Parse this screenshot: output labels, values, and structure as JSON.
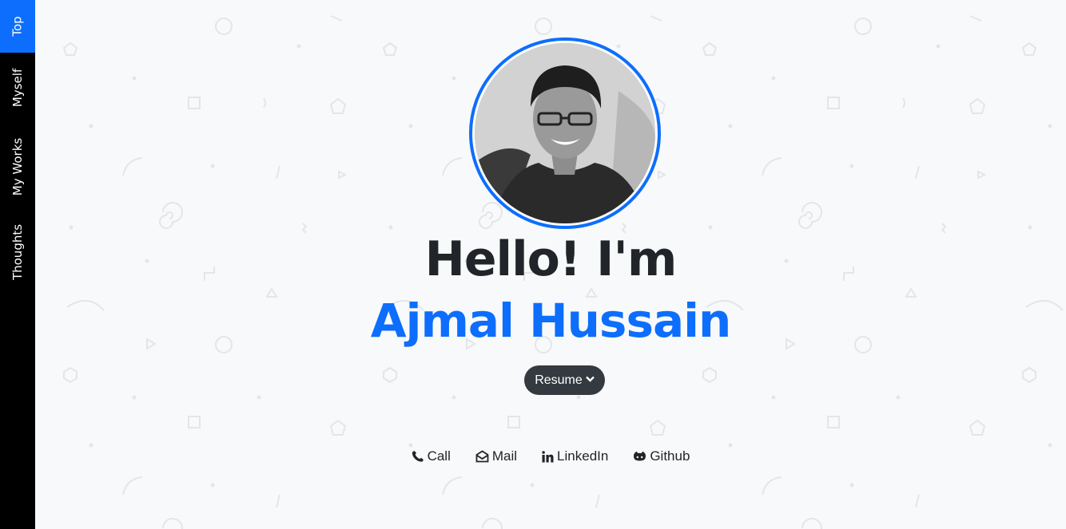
{
  "sidebar": {
    "items": [
      {
        "label": "Top"
      },
      {
        "label": "Myself"
      },
      {
        "label": "My Works"
      },
      {
        "label": "Thoughts"
      }
    ]
  },
  "hero": {
    "greeting": "Hello! I'm",
    "name": "Ajmal Hussain",
    "resume_label": "Resume"
  },
  "contacts": {
    "call": "Call",
    "mail": "Mail",
    "linkedin": "LinkedIn",
    "github": "Github"
  },
  "colors": {
    "accent": "#0d6efd",
    "sidebar_bg": "#000000",
    "button_bg": "#343a40",
    "page_bg": "#f8f9fa"
  },
  "icons": {
    "call": "phone-icon",
    "mail": "envelope-icon",
    "linkedin": "linkedin-icon",
    "github": "github-icon",
    "resume": "chevron-down-icon"
  }
}
